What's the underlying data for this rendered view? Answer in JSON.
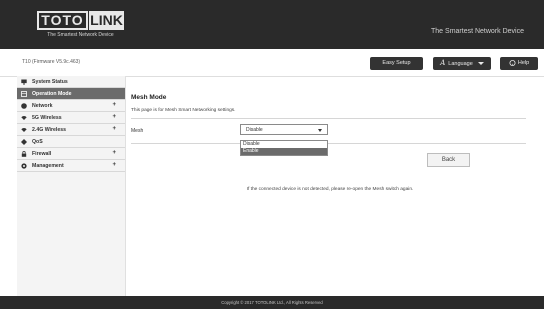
{
  "header": {
    "logo_toto": "TOTO",
    "logo_link": "LINK",
    "logo_tagline": "The Smartest Network Device",
    "slogan": "The Smartest Network Device"
  },
  "toolbar": {
    "firmware": "T10 (Firmware V5.9c.463)",
    "easy_setup": "Easy Setup",
    "language": "Language",
    "help": "Help"
  },
  "sidebar": {
    "items": [
      {
        "label": "System Status",
        "icon": "monitor-icon",
        "expandable": false,
        "active": false
      },
      {
        "label": "Operation Mode",
        "icon": "operation-mode-icon",
        "expandable": false,
        "active": true
      },
      {
        "label": "Network",
        "icon": "globe-icon",
        "expandable": true,
        "active": false
      },
      {
        "label": "5G Wireless",
        "icon": "wifi-icon",
        "expandable": true,
        "active": false
      },
      {
        "label": "2.4G Wireless",
        "icon": "wifi-icon",
        "expandable": true,
        "active": false
      },
      {
        "label": "QoS",
        "icon": "qos-icon",
        "expandable": false,
        "active": false
      },
      {
        "label": "Firewall",
        "icon": "lock-icon",
        "expandable": true,
        "active": false
      },
      {
        "label": "Management",
        "icon": "gear-icon",
        "expandable": true,
        "active": false
      }
    ],
    "plus": "+"
  },
  "main": {
    "title": "Mesh Mode",
    "description": "This page is for Mesh Smart Networking settings.",
    "mesh_label": "Mesh",
    "mesh_value": "Disable",
    "mesh_options": [
      "Disable",
      "Enable"
    ],
    "highlighted_option": "Enable",
    "back": "Back",
    "note": "If the connected device is not detected, please re-open the Mesh switch again."
  },
  "footer": {
    "copyright": "Copyright © 2017 TOTOLINK Ltd.,  All Rights Reserved"
  },
  "colors": {
    "header_bg": "#2a2a2a",
    "active_item": "#6b6b6b",
    "sidebar_bg": "#f4f4f4"
  }
}
